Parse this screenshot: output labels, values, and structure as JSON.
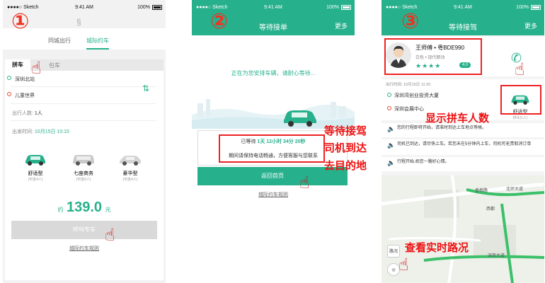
{
  "colors": {
    "brand": "#27b08c",
    "accent_red": "#ee2222"
  },
  "status": {
    "carrier": "●●●●○ Sketch",
    "time": "9:41 AM",
    "battery": "100%"
  },
  "step_numbers": [
    "①",
    "②",
    "③"
  ],
  "screen1": {
    "mode_tabs": [
      "同城出行",
      "城际约车"
    ],
    "sub_tabs": [
      "拼车",
      "包车"
    ],
    "from": "深圳北站",
    "to": "儿童世界",
    "passengers_label": "出行人数:",
    "passengers_value": "1人",
    "time_label": "出发时间:",
    "time_value": "10月15日 10:15",
    "cars": [
      {
        "name": "舒适型",
        "sub": "(可坐4人)"
      },
      {
        "name": "七座商务",
        "sub": "(可坐6人)"
      },
      {
        "name": "豪华型",
        "sub": "(可坐4人)"
      }
    ],
    "price_prefix": "约",
    "price_value": "139.0",
    "price_suffix": "元",
    "call_button": "呼叫专车",
    "rules_link": "城际约车规则"
  },
  "screen2": {
    "title": "等待接单",
    "more": "更多",
    "message": "正在为您安排车辆，请耐心等待...",
    "waited_prefix": "已等待",
    "waited_value": "1天 12小时 34分 20秒",
    "keep_phone": "期间请保持电话畅通，方便客服与您联系",
    "home_button": "返回首页",
    "rules_link": "城际约车规则"
  },
  "screen3": {
    "title": "等待接驾",
    "more": "更多",
    "driver_name": "王师傅 • 粤BDE990",
    "car_desc": "白色 • 现代朗动",
    "stars": "★★★★",
    "rating": "4.0",
    "trip_time": "出行时间: 10月15日 11:20",
    "from": "深圳湾创业投资大厦",
    "to": "深圳会展中心",
    "car_type": "舒适型",
    "car_count": "拼车(1人)",
    "notices": [
      "您的行程即将开始，请准时到达上车地点等候。",
      "司机已到达，请尽快上车。若您未在5分钟内上车，司机可无责取消订单",
      "行程开始,祝您一路好心情。"
    ],
    "map_label": "路况",
    "map_roads": [
      "香梅路",
      "北环大道",
      "西都",
      "深南大道"
    ]
  },
  "annotations": {
    "show_count": "显示拼车人数",
    "waiting_pickup": "等待接驾",
    "driver_arrived": "司机到达",
    "destination": "去目的地",
    "realtime_traffic": "查看实时路况"
  }
}
